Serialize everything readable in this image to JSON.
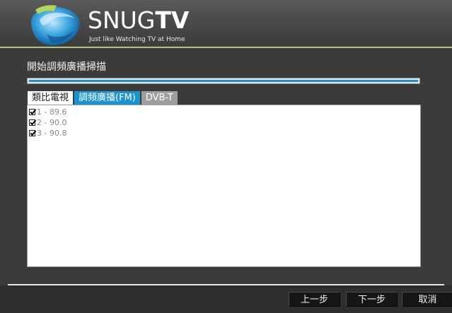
{
  "app": {
    "logo_text_light": "SNUG",
    "logo_text_bold": "TV",
    "tagline": "Just like Watching TV at Home"
  },
  "page": {
    "title": "開始調頻廣播掃描",
    "progress": 1.0
  },
  "tabs": [
    {
      "label": "類比電視",
      "state": "normal"
    },
    {
      "label": "調頻廣播(FM)",
      "state": "selected"
    },
    {
      "label": "DVB-T",
      "state": "disabled"
    }
  ],
  "channels": [
    {
      "label": "1 - 89.6",
      "checked": true
    },
    {
      "label": "2 - 90.0",
      "checked": true
    },
    {
      "label": "3 - 90.8",
      "checked": true
    }
  ],
  "buttons": {
    "back": "上一步",
    "next": "下一步",
    "cancel": "取消"
  },
  "colors": {
    "accent": "#1a93d2",
    "header_line": "#b9c07a",
    "background": "#3b3b3b"
  }
}
